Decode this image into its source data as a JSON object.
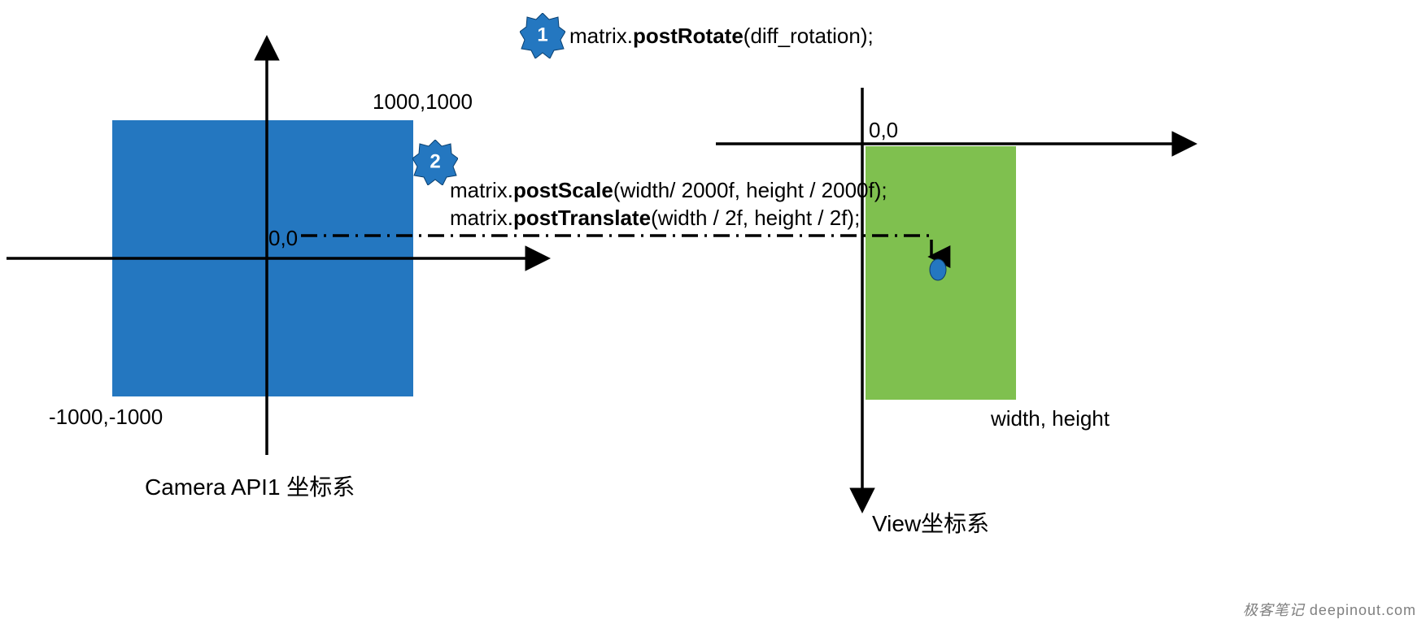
{
  "colors": {
    "blue": "#2477c0",
    "green": "#7fc04f",
    "axis": "#000000",
    "dashed": "#000000"
  },
  "left_diagram": {
    "title": "Camera API1 坐标系",
    "origin_label": "0,0",
    "top_right_label": "1000,1000",
    "bottom_left_label": "-1000,-1000"
  },
  "right_diagram": {
    "title": "View坐标系",
    "origin_label": "0,0",
    "bottom_right_label": "width, height"
  },
  "steps": {
    "one": {
      "num": "1",
      "text_prefix": "matrix.",
      "text_bold": "postRotate",
      "text_suffix": "(diff_rotation);"
    },
    "two": {
      "num": "2",
      "line1_prefix": "matrix.",
      "line1_bold": "postScale",
      "line1_suffix": "(width/ 2000f, height / 2000f);",
      "line2_prefix": "matrix.",
      "line2_bold": "postTranslate",
      "line2_suffix": "(width / 2f, height / 2f);"
    }
  },
  "watermark": {
    "brand": "极客笔记",
    "site": "deepinout.com"
  }
}
